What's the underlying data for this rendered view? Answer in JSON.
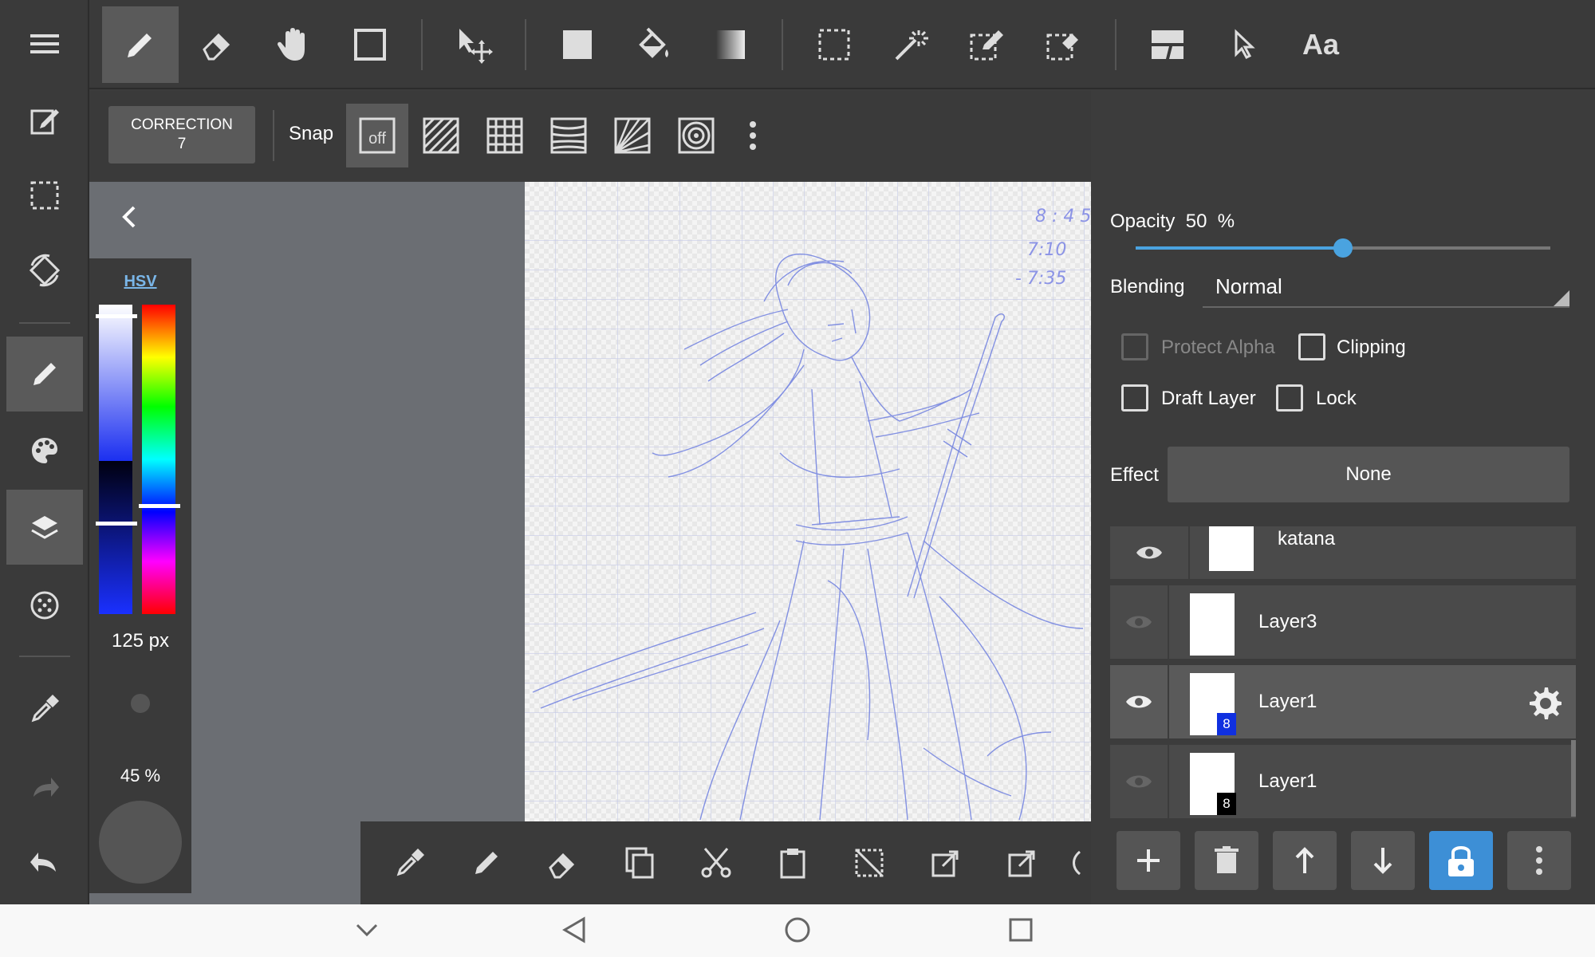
{
  "toolbar": {
    "correction_label": "CORRECTION",
    "correction_value": "7",
    "snap_label": "Snap",
    "snap_off_label": "off",
    "text_tool_label": "Aa"
  },
  "color_panel": {
    "mode_label": "HSV",
    "brush_size": "125 px",
    "brush_opacity": "45 %"
  },
  "layer_panel": {
    "opacity_label": "Opacity",
    "opacity_value": "50",
    "opacity_unit": "%",
    "opacity_fraction": 0.5,
    "blending_label": "Blending",
    "blending_value": "Normal",
    "protect_alpha_label": "Protect Alpha",
    "clipping_label": "Clipping",
    "draft_layer_label": "Draft Layer",
    "lock_label": "Lock",
    "effect_label": "Effect",
    "effect_value": "None",
    "layers": [
      {
        "name": "katana",
        "visible": true
      },
      {
        "name": "Layer3",
        "visible": false
      },
      {
        "name": "Layer1",
        "visible": true,
        "badge": "8",
        "badge_color": "#1030e0",
        "selected": true
      },
      {
        "name": "Layer1",
        "visible": false,
        "badge": "8",
        "badge_color": "#000000"
      }
    ]
  },
  "colors": {
    "accent": "#3d8fd6",
    "sketch": "#7080e0"
  },
  "canvas_notes": [
    "8 : 4 5",
    "7:10",
    "- 7:35"
  ]
}
